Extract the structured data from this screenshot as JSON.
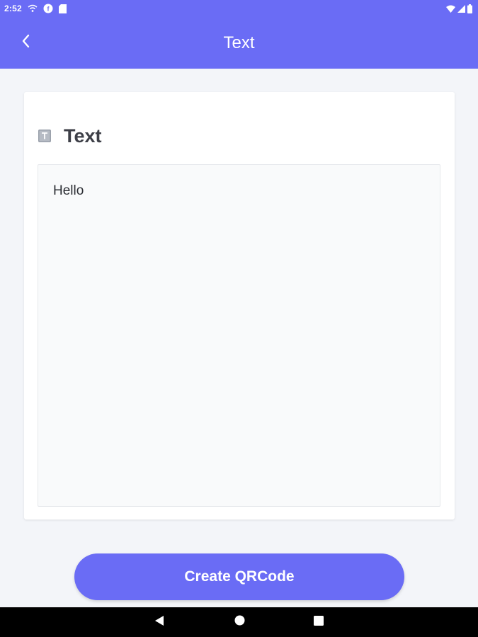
{
  "status_bar": {
    "time": "2:52",
    "left_icons": [
      "wifi-call-icon",
      "app-notification-icon",
      "sd-card-icon"
    ],
    "right_icons": [
      "wifi-icon",
      "signal-icon",
      "battery-icon"
    ]
  },
  "app_bar": {
    "title": "Text",
    "back_icon": "chevron-left-icon"
  },
  "card": {
    "icon": "text-type-icon",
    "title": "Text",
    "input_value": "Hello"
  },
  "actions": {
    "create_label": "Create QRCode"
  },
  "nav_bar": {
    "buttons": [
      "back-triangle-icon",
      "home-circle-icon",
      "recents-square-icon"
    ]
  },
  "colors": {
    "primary": "#6a6cf5",
    "background": "#f3f5f9",
    "card": "#ffffff",
    "input_bg": "#f9fafb",
    "title_text": "#3d3f47"
  }
}
